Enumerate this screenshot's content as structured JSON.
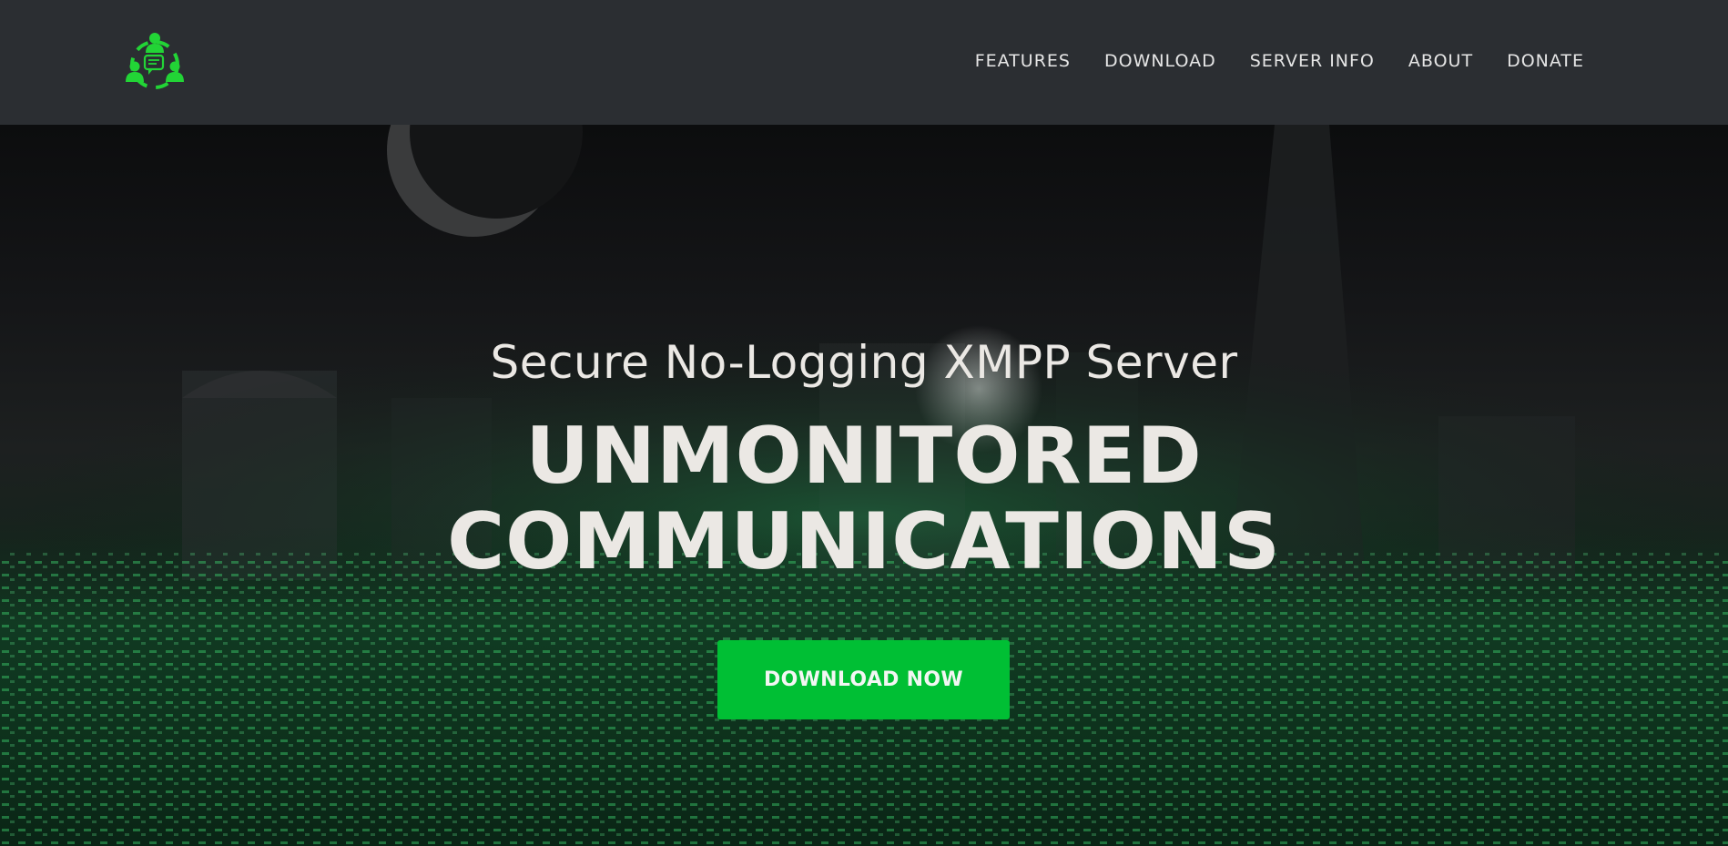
{
  "brand": {
    "logo_icon": "group-chat-icon",
    "accent_color": "#00bf34"
  },
  "nav": {
    "items": [
      {
        "label": "FEATURES"
      },
      {
        "label": "DOWNLOAD"
      },
      {
        "label": "SERVER INFO"
      },
      {
        "label": "ABOUT"
      },
      {
        "label": "DONATE"
      }
    ]
  },
  "hero": {
    "subtitle": "Secure No-Logging XMPP Server",
    "title_line1": "UNMONITORED",
    "title_line2": "COMMUNICATIONS",
    "cta_label": "DOWNLOAD NOW",
    "background": "dark-city-skyline-with-crescent-moon-and-green-digital-rain"
  }
}
